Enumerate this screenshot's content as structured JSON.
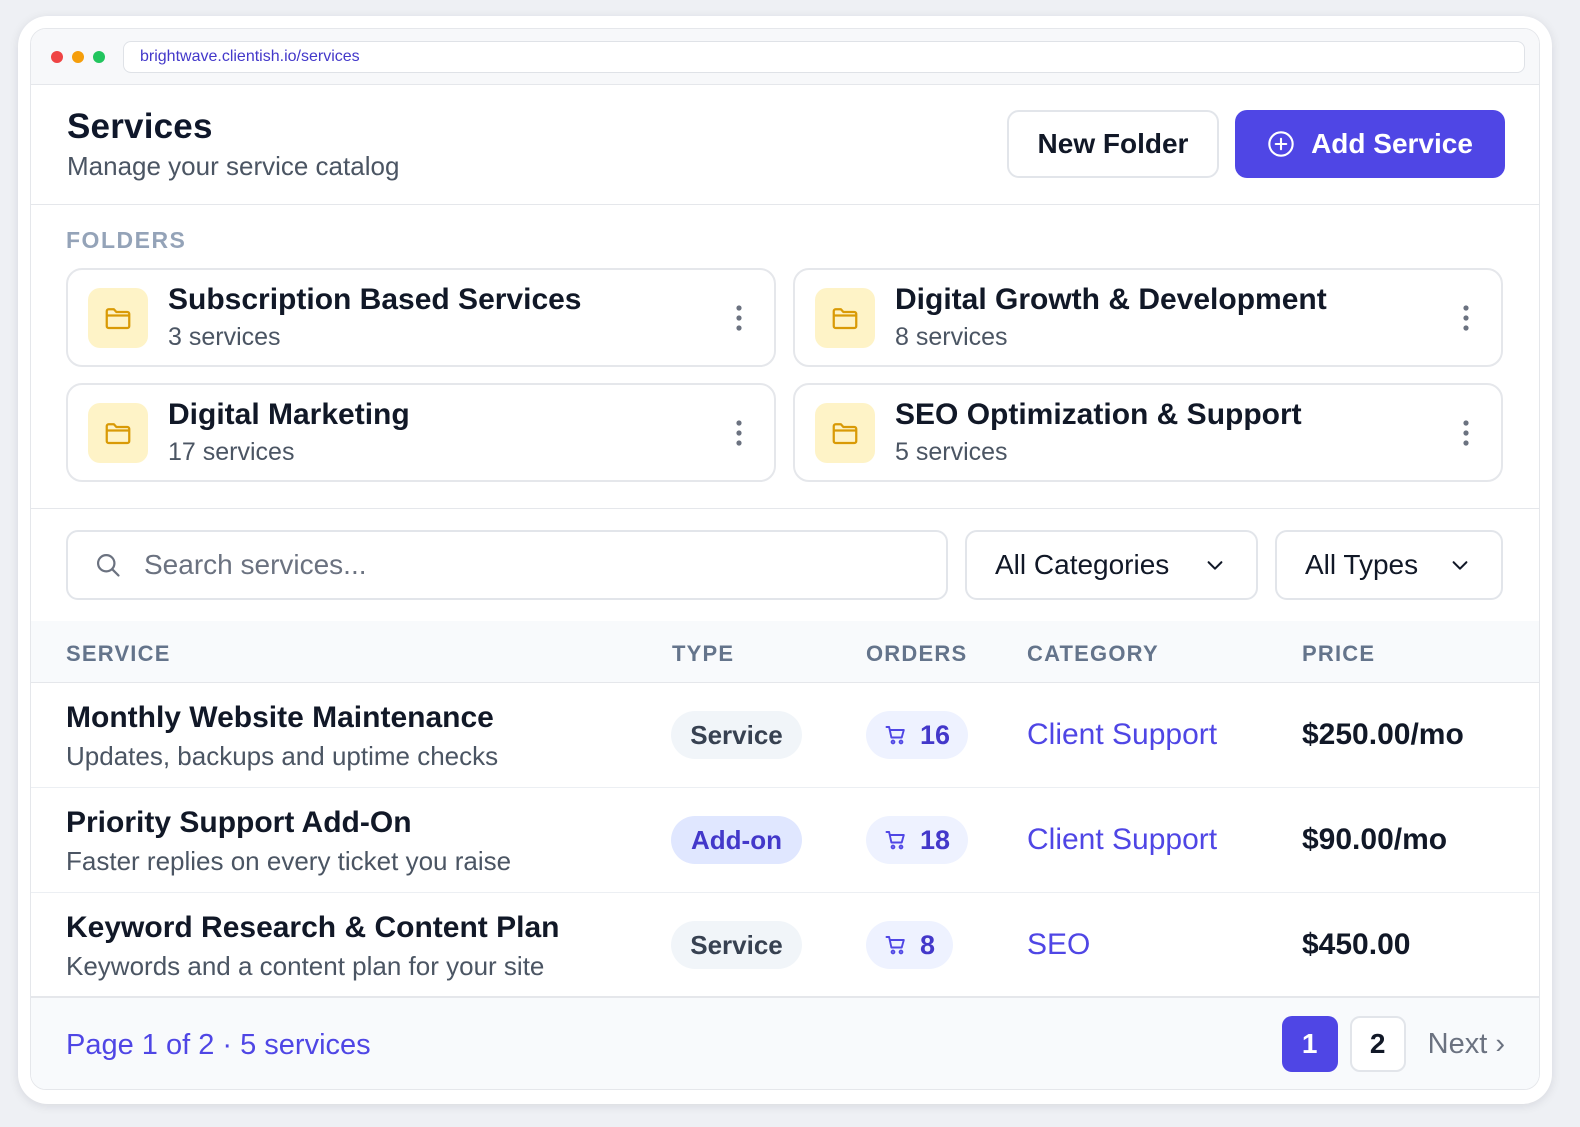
{
  "browser": {
    "url": "brightwave.clientish.io/services"
  },
  "header": {
    "title": "Services",
    "subtitle": "Manage your service catalog",
    "new_folder_label": "New Folder",
    "add_service_label": "Add Service"
  },
  "folders": {
    "label": "FOLDERS",
    "items": [
      {
        "name": "Subscription Based Services",
        "count": "3 services"
      },
      {
        "name": "Digital Growth & Development",
        "count": "8 services"
      },
      {
        "name": "Digital Marketing",
        "count": "17 services"
      },
      {
        "name": "SEO Optimization & Support",
        "count": "5 services"
      }
    ]
  },
  "filters": {
    "search_placeholder": "Search services...",
    "category_selected": "All Categories",
    "type_selected": "All Types"
  },
  "table": {
    "columns": [
      "SERVICE",
      "TYPE",
      "ORDERS",
      "CATEGORY",
      "PRICE"
    ],
    "rows": [
      {
        "name": "Monthly Website Maintenance",
        "description": "Updates, backups and uptime checks",
        "type": "Service",
        "orders": "16",
        "category": "Client Support",
        "price": "$250.00/mo"
      },
      {
        "name": "Priority Support Add-On",
        "description": "Faster replies on every ticket you raise",
        "type": "Add-on",
        "orders": "18",
        "category": "Client Support",
        "price": "$90.00/mo"
      },
      {
        "name": "Keyword Research & Content Plan",
        "description": "Keywords and a content plan for your site",
        "type": "Service",
        "orders": "8",
        "category": "SEO",
        "price": "$450.00"
      }
    ]
  },
  "footer": {
    "info": "Page 1 of 2 · 5 services",
    "pages": [
      "1",
      "2"
    ],
    "next_label": "Next ›"
  },
  "colors": {
    "primary": "#4f46e5",
    "folder_bg": "#fef3c7",
    "folder_icon": "#d99a06"
  },
  "icons": [
    "plus-circle-icon",
    "folder-icon",
    "more-vertical-icon",
    "search-icon",
    "chevron-down-icon",
    "cart-icon"
  ]
}
